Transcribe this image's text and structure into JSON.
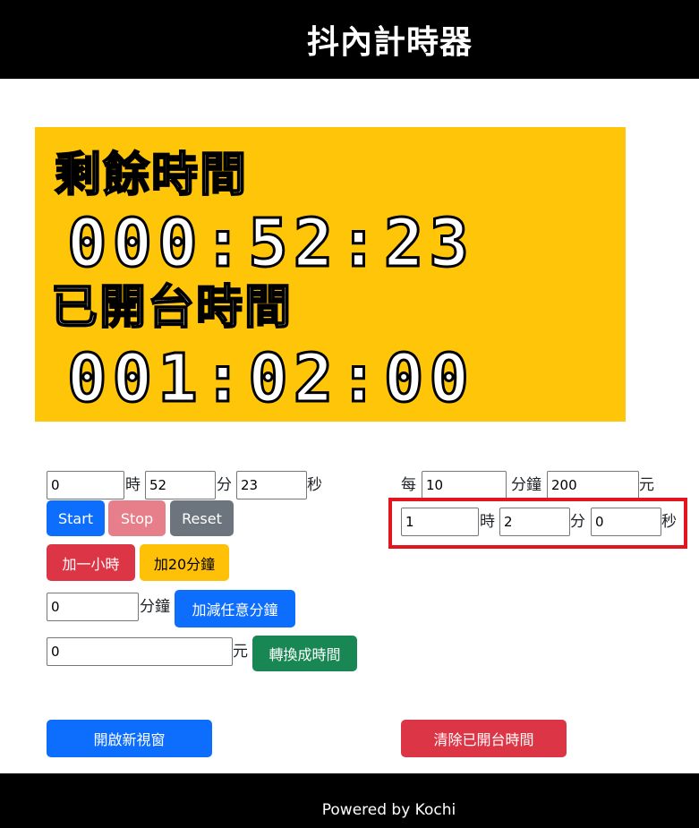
{
  "header": {
    "title": "抖內計時器"
  },
  "display": {
    "remaining_label": "剩餘時間",
    "remaining_time": "000:52:23",
    "opened_label": "已開台時間",
    "opened_time": "001:02:00"
  },
  "timer_inputs": {
    "hours": "0",
    "hours_unit": "時",
    "minutes": "52",
    "minutes_unit": "分",
    "seconds": "23",
    "seconds_unit": "秒"
  },
  "controls": {
    "start": "Start",
    "stop": "Stop",
    "reset": "Reset",
    "add_hour": "加一小時",
    "add_20min": "加20分鐘"
  },
  "adjust": {
    "minutes_value": "0",
    "minutes_unit": "分鐘",
    "button": "加減任意分鐘"
  },
  "convert": {
    "amount_value": "0",
    "amount_unit": "元",
    "button": "轉換成時間"
  },
  "rate": {
    "prefix": "每",
    "minutes_value": "10",
    "minutes_unit": "分鐘",
    "amount_value": "200",
    "amount_unit": "元"
  },
  "opened_inputs": {
    "hours": "1",
    "hours_unit": "時",
    "minutes": "2",
    "minutes_unit": "分",
    "seconds": "0",
    "seconds_unit": "秒"
  },
  "actions": {
    "open_window": "開啟新視窗",
    "clear_opened": "清除已開台時間"
  },
  "footer": {
    "text": "Powered by Kochi"
  },
  "colors": {
    "display_bg": "#ffc609",
    "primary": "#0d6efd",
    "danger": "#dc3545",
    "secondary": "#6c757d",
    "warning": "#ffc107",
    "success": "#198754",
    "highlight": "#e3151e"
  }
}
